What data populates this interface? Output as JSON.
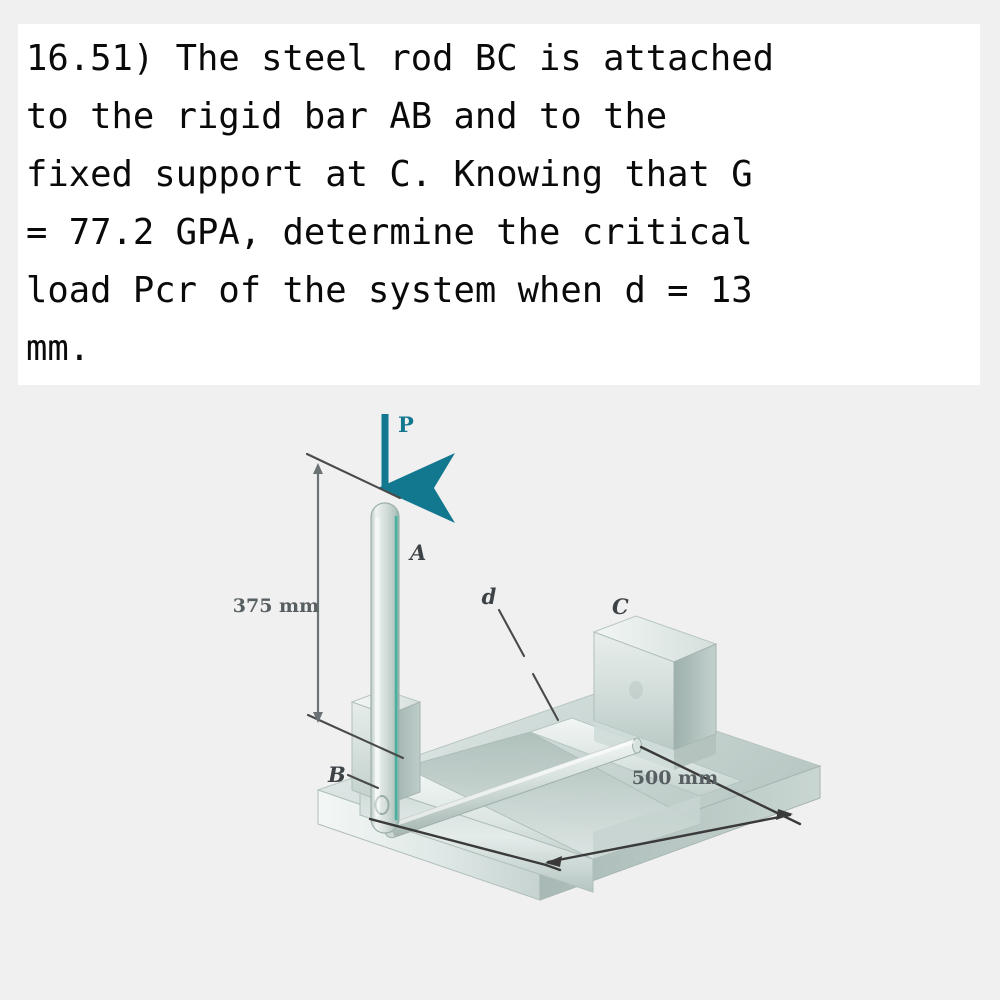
{
  "page": {
    "background_color": "#f0f0f0",
    "panel_color": "#ffffff"
  },
  "problem": {
    "number": "16.51)",
    "text": "16.51) The steel rod BC is attached\nto the rigid bar AB and to the\nfixed support at C. Knowing that G\n= 77.2 GPA, determine the critical\nload Pcr of the system when d = 13\nmm."
  },
  "figure": {
    "caption_labels": {
      "force": "P",
      "point_a": "A",
      "point_b": "B",
      "point_c": "C",
      "diameter": "d"
    },
    "dimensions": {
      "vertical": "375 mm",
      "horizontal": "500 mm"
    },
    "colors": {
      "force_arrow": "#12788f",
      "bar_edge_highlight": "#3fae9c",
      "metal_light": "#eef2f1",
      "metal_mid": "#ccd8d5",
      "metal_dark": "#9fb0ac",
      "leader_line": "#3a3a3a",
      "dimension_text": "#585f63"
    }
  }
}
